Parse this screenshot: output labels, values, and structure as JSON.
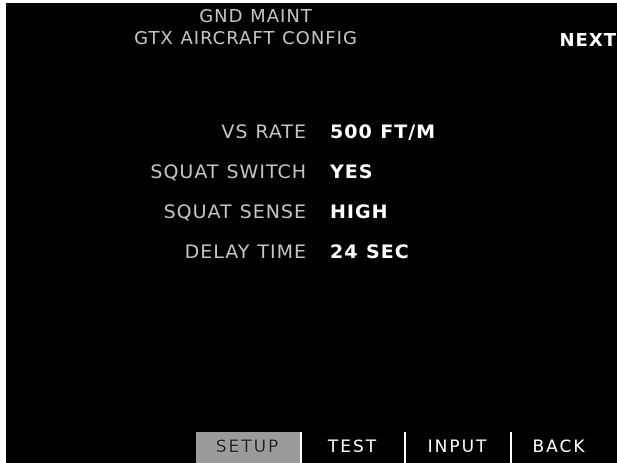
{
  "header": {
    "line1": "GND MAINT",
    "line2": "GTX AIRCRAFT CONFIG",
    "next_label": "NEXT"
  },
  "params": [
    {
      "label": "VS RATE",
      "value": "500 FT/M"
    },
    {
      "label": "SQUAT SWITCH",
      "value": "YES"
    },
    {
      "label": "SQUAT SENSE",
      "value": "HIGH"
    },
    {
      "label": "DELAY TIME",
      "value": "24 SEC"
    }
  ],
  "softkeys": [
    {
      "label": "SETUP",
      "active": true
    },
    {
      "label": "TEST",
      "active": false
    },
    {
      "label": "INPUT",
      "active": false
    },
    {
      "label": "BACK",
      "active": false
    }
  ],
  "colors": {
    "background": "#000000",
    "label_text": "#c4c4c4",
    "value_text": "#ffffff",
    "active_softkey": "#9a9a9a"
  }
}
